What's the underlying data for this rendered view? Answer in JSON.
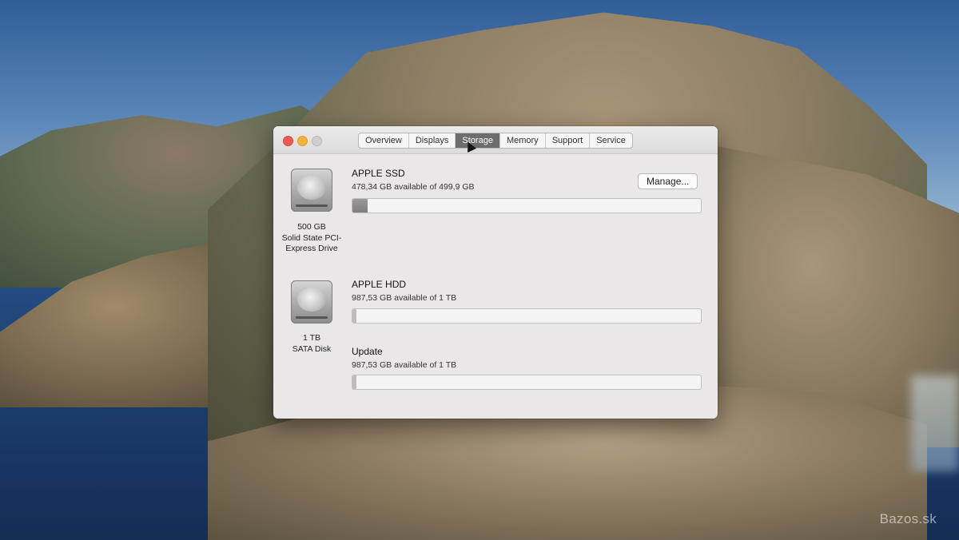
{
  "wallpaper": {
    "watermark": "Bazos.sk"
  },
  "window": {
    "tabs": [
      {
        "label": "Overview",
        "active": false
      },
      {
        "label": "Displays",
        "active": false
      },
      {
        "label": "Storage",
        "active": true
      },
      {
        "label": "Memory",
        "active": false
      },
      {
        "label": "Support",
        "active": false
      },
      {
        "label": "Service",
        "active": false
      }
    ]
  },
  "storage": {
    "drives": [
      {
        "icon": "hard-drive-icon",
        "capacity": "500 GB",
        "type_line1": "Solid State PCI-",
        "type_line2": "Express Drive",
        "volumes": [
          {
            "name": "APPLE SSD",
            "availability": "478,34 GB available of 499,9 GB",
            "used_fraction": 0.043,
            "manage_label": "Manage..."
          }
        ]
      },
      {
        "icon": "hard-drive-icon",
        "capacity": "1 TB",
        "type_line1": "SATA Disk",
        "volumes": [
          {
            "name": "APPLE HDD",
            "availability": "987,53 GB available of 1 TB",
            "used_fraction": 0.012
          },
          {
            "name": "Update",
            "availability": "987,53 GB available of 1 TB",
            "used_fraction": 0.012
          }
        ]
      }
    ]
  }
}
